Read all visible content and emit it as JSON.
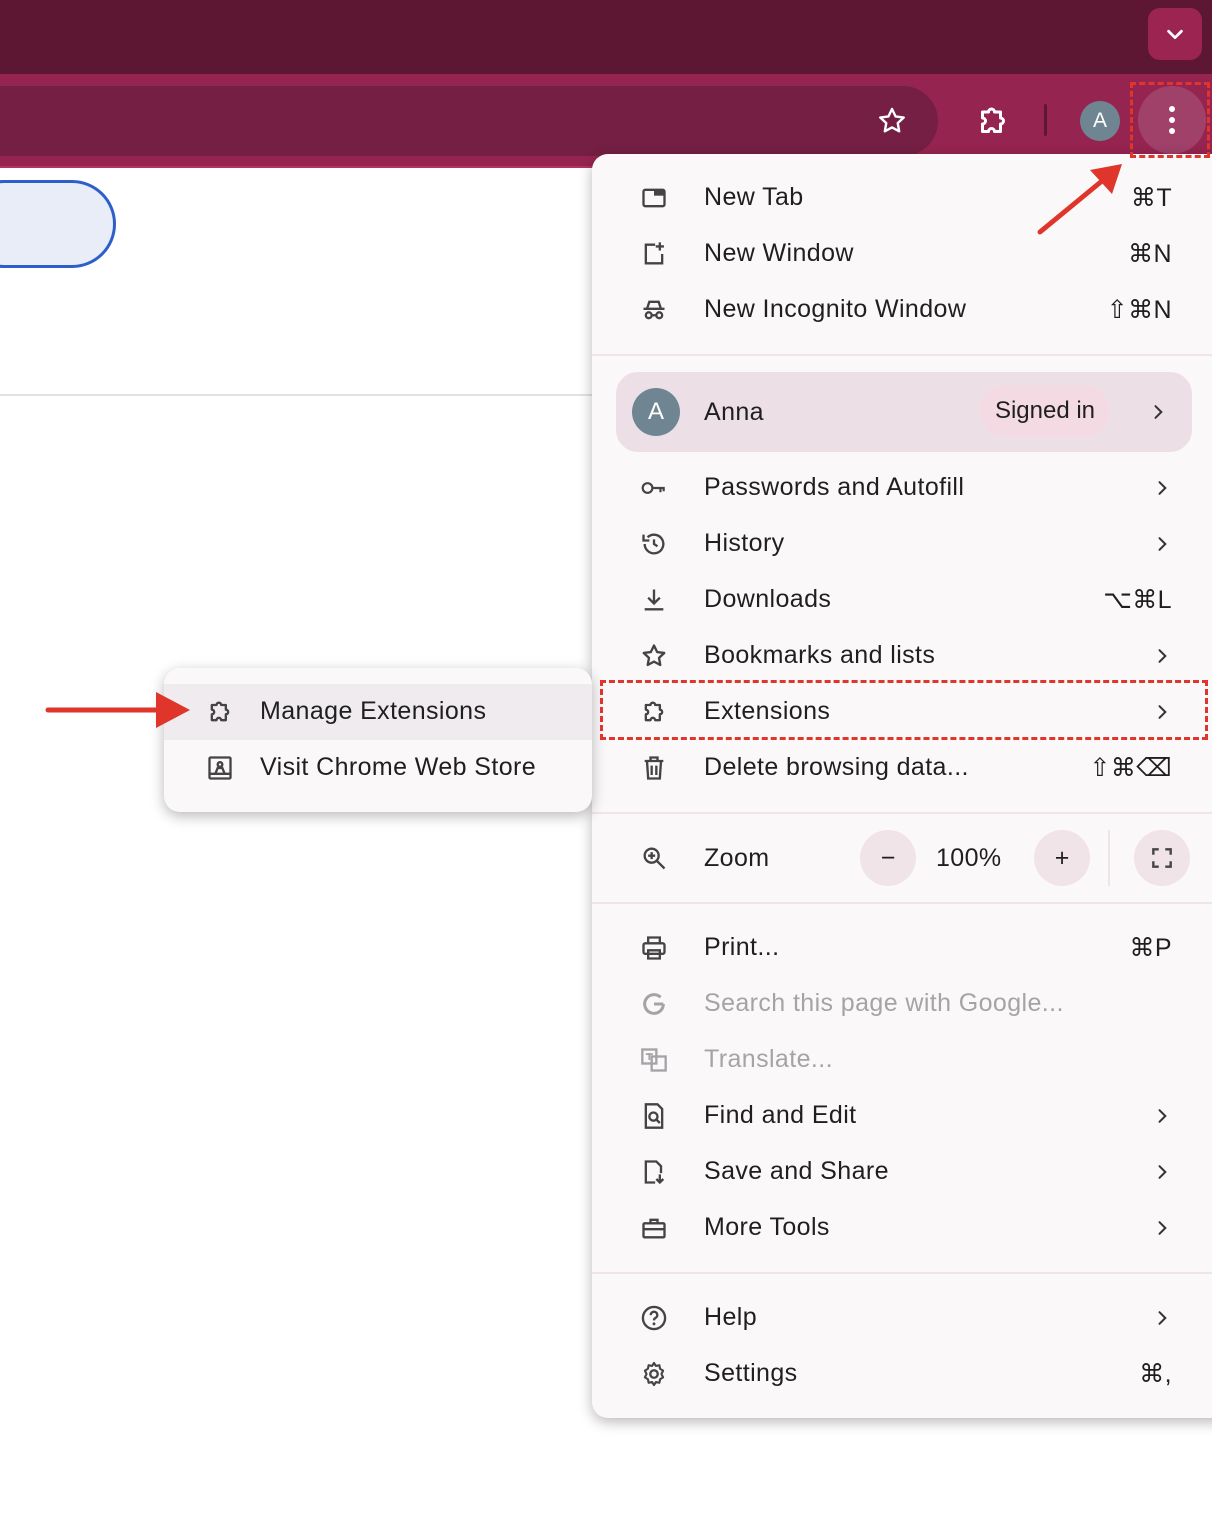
{
  "colors": {
    "tabstrip": "#5e1733",
    "toolbar": "#962450",
    "omnibox": "#741f43",
    "menu_bg": "#fbf8fa",
    "annotation": "#e0352a",
    "avatar": "#6f8592"
  },
  "toolbar": {
    "avatar_initial": "A",
    "icons": [
      "star-icon",
      "puzzle-icon",
      "kebab-icon",
      "chevron-down-icon"
    ]
  },
  "menu": {
    "new_tab": {
      "label": "New Tab",
      "shortcut": "⌘T",
      "icon": "new-tab-icon"
    },
    "new_window": {
      "label": "New Window",
      "shortcut": "⌘N",
      "icon": "new-window-icon"
    },
    "new_incognito": {
      "label": "New Incognito Window",
      "shortcut": "⇧⌘N",
      "icon": "incognito-icon"
    },
    "profile": {
      "initial": "A",
      "name": "Anna",
      "status": "Signed in"
    },
    "passwords": {
      "label": "Passwords and Autofill",
      "icon": "key-icon"
    },
    "history": {
      "label": "History",
      "icon": "history-icon"
    },
    "downloads": {
      "label": "Downloads",
      "shortcut": "⌥⌘L",
      "icon": "download-icon"
    },
    "bookmarks": {
      "label": "Bookmarks and lists",
      "icon": "star-icon"
    },
    "extensions": {
      "label": "Extensions",
      "icon": "puzzle-icon"
    },
    "delete_data": {
      "label": "Delete browsing data...",
      "shortcut": "⇧⌘⌫",
      "icon": "trash-icon"
    },
    "zoom": {
      "label": "Zoom",
      "minus": "−",
      "value": "100%",
      "plus": "+"
    },
    "print": {
      "label": "Print...",
      "shortcut": "⌘P",
      "icon": "printer-icon"
    },
    "search_google": {
      "label": "Search this page with Google...",
      "icon": "google-icon"
    },
    "translate": {
      "label": "Translate...",
      "icon": "translate-icon"
    },
    "find_edit": {
      "label": "Find and Edit",
      "icon": "find-icon"
    },
    "save_share": {
      "label": "Save and Share",
      "icon": "save-share-icon"
    },
    "more_tools": {
      "label": "More Tools",
      "icon": "toolbox-icon"
    },
    "help": {
      "label": "Help",
      "icon": "help-icon"
    },
    "settings": {
      "label": "Settings",
      "shortcut": "⌘,",
      "icon": "gear-icon"
    }
  },
  "submenu": {
    "manage_extensions": {
      "label": "Manage Extensions",
      "icon": "puzzle-icon"
    },
    "web_store": {
      "label": "Visit Chrome Web Store",
      "icon": "web-store-icon"
    }
  }
}
